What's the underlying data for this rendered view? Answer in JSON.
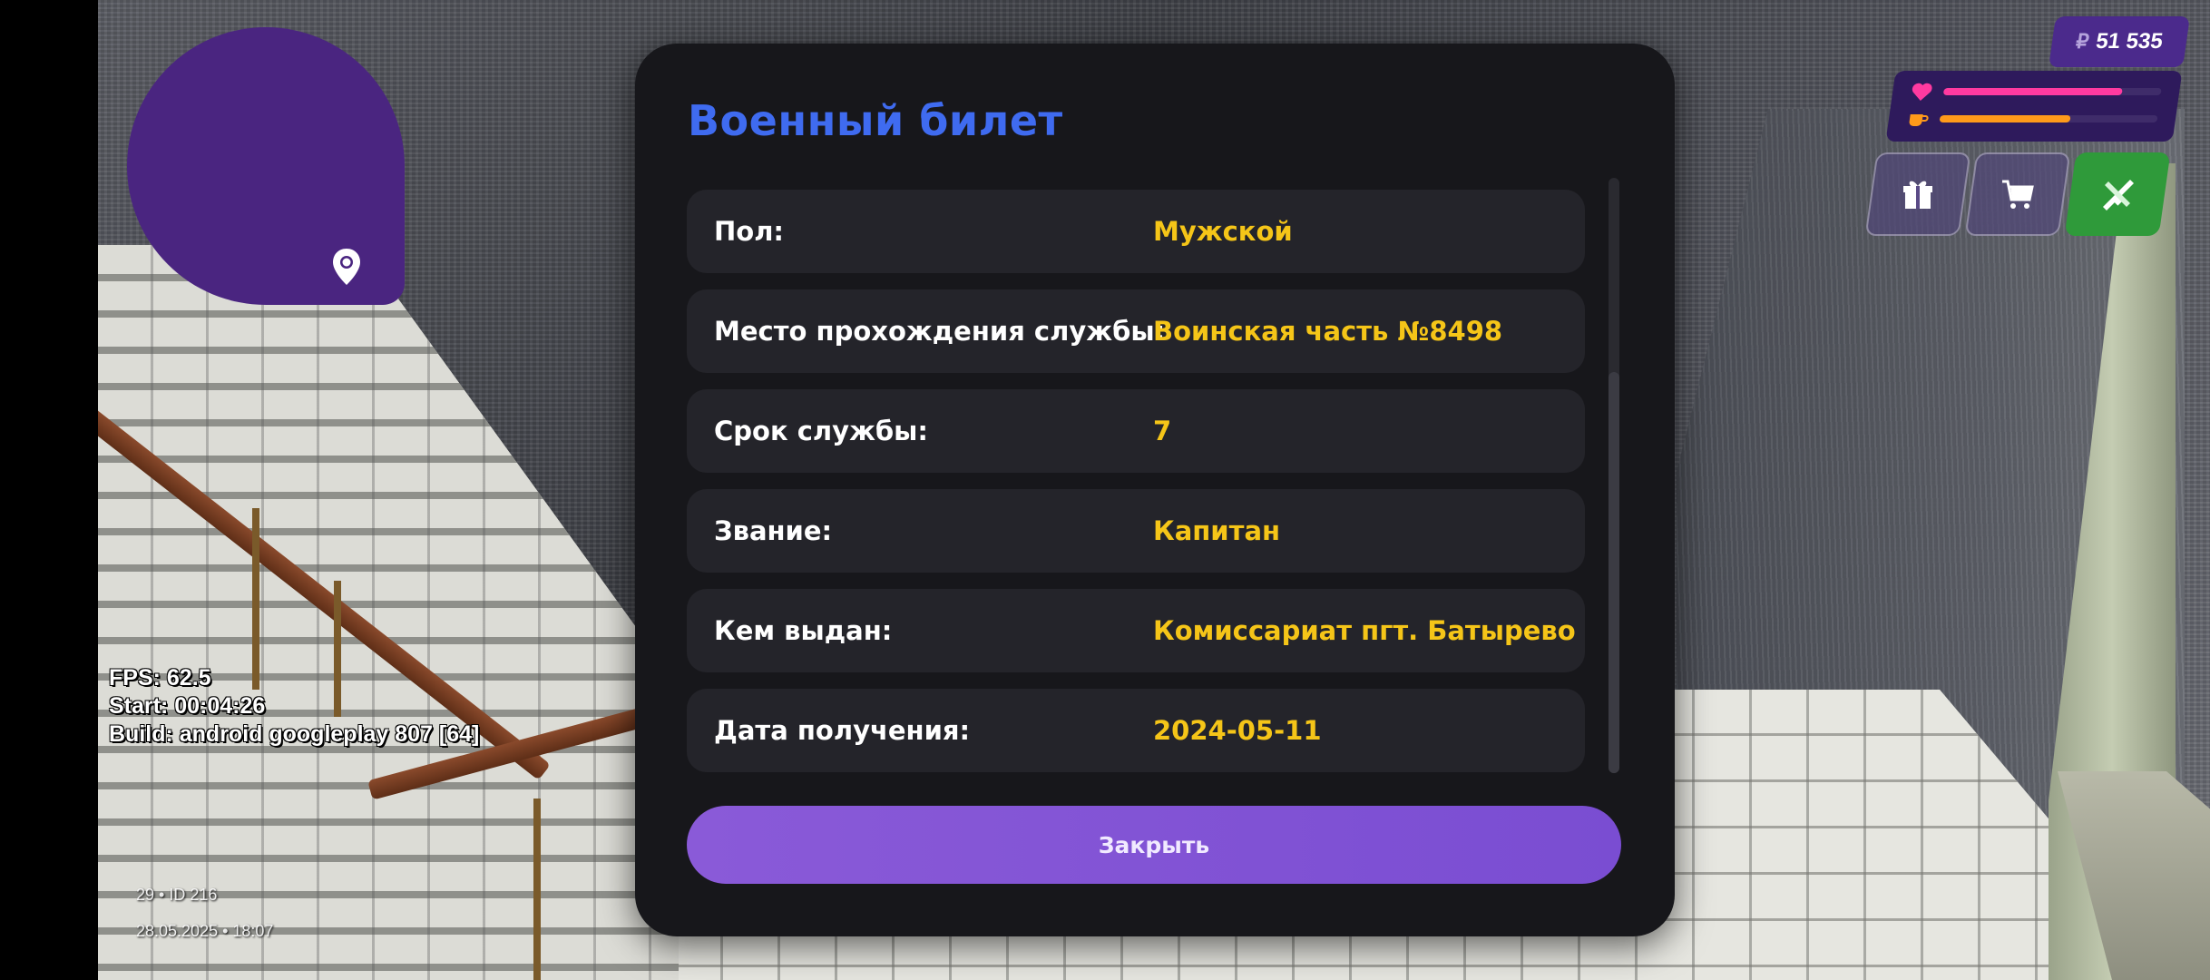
{
  "hud": {
    "money_currency": "₽",
    "money": "51 535",
    "health_fraction": 0.82,
    "hunger_fraction": 0.6,
    "health_color": "#ff3aa0",
    "hunger_color": "#ff9a1a",
    "buttons": [
      {
        "icon": "gift-icon"
      },
      {
        "icon": "cart-icon"
      },
      {
        "icon": "weapon-icon"
      }
    ]
  },
  "debug": {
    "fps": "FPS: 62.5",
    "start": "Start: 00:04:26",
    "build": "Build: android googleplay 807 [64]"
  },
  "player": {
    "id_line": "29 • ID 216",
    "datetime": "28.05.2025 • 18:07"
  },
  "dialog": {
    "title": "Военный билет",
    "rows": [
      {
        "label": "Пол:",
        "value": "Мужской"
      },
      {
        "label": "Место прохождения службы:",
        "value": "Воинская часть №8498"
      },
      {
        "label": "Срок службы:",
        "value": "7"
      },
      {
        "label": "Звание:",
        "value": "Капитан"
      },
      {
        "label": "Кем выдан:",
        "value": "Комиссариат пгт. Батырево"
      },
      {
        "label": "Дата получения:",
        "value": "2024-05-11"
      }
    ],
    "close_label": "Закрыть",
    "title_color": "#3f6bf0",
    "value_color": "#f5c518",
    "button_color": "#8a5ad8"
  },
  "minimap": {
    "color": "#4a2580",
    "icon": "location-pin-icon"
  }
}
